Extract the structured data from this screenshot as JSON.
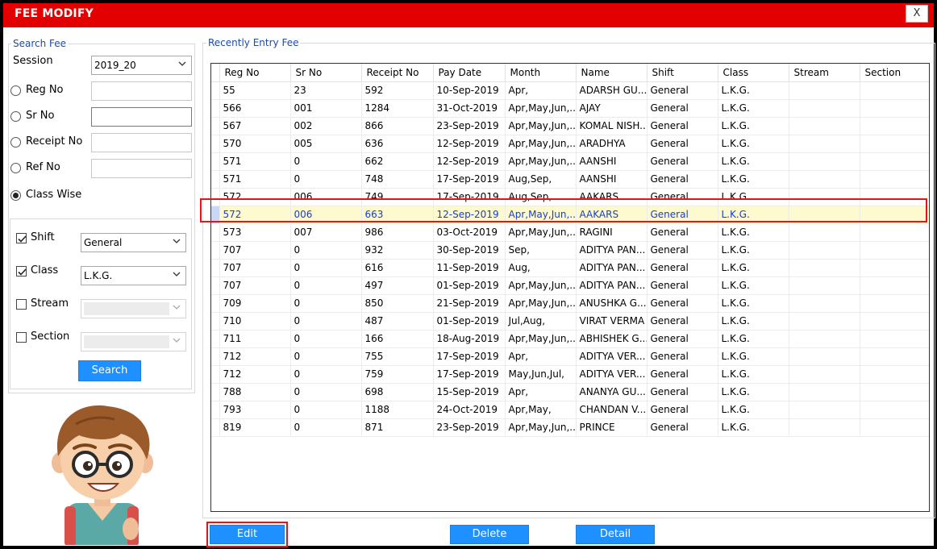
{
  "window": {
    "title": "FEE MODIFY",
    "close_label": "X"
  },
  "search_fee": {
    "legend": "Search Fee",
    "session_label": "Session",
    "session_value": "2019_20",
    "options": [
      {
        "label": "Reg No",
        "checked": false
      },
      {
        "label": "Sr No",
        "checked": false
      },
      {
        "label": "Receipt No",
        "checked": false
      },
      {
        "label": "Ref No",
        "checked": false
      },
      {
        "label": "Class Wise",
        "checked": true
      }
    ],
    "filters": {
      "shift_label": "Shift",
      "shift_checked": true,
      "shift_value": "General",
      "class_label": "Class",
      "class_checked": true,
      "class_value": "L.K.G.",
      "stream_label": "Stream",
      "stream_checked": false,
      "stream_value": "",
      "section_label": "Section",
      "section_checked": false,
      "section_value": ""
    },
    "search_label": "Search"
  },
  "recent": {
    "legend": "Recently Entry Fee",
    "columns": [
      "Reg No",
      "Sr No",
      "Receipt No",
      "Pay Date",
      "Month",
      "Name",
      "Shift",
      "Class",
      "Stream",
      "Section"
    ],
    "selected_index": 7,
    "rows": [
      [
        "55",
        "23",
        "592",
        "10-Sep-2019",
        "Apr,",
        "ADARSH GU...",
        "General",
        "L.K.G.",
        "",
        ""
      ],
      [
        "566",
        "001",
        "1284",
        "31-Oct-2019",
        "Apr,May,Jun,...",
        "AJAY",
        "General",
        "L.K.G.",
        "",
        ""
      ],
      [
        "567",
        "002",
        "866",
        "23-Sep-2019",
        "Apr,May,Jun,...",
        "KOMAL NISH...",
        "General",
        "L.K.G.",
        "",
        ""
      ],
      [
        "570",
        "005",
        "636",
        "12-Sep-2019",
        "Apr,May,Jun,...",
        "ARADHYA",
        "General",
        "L.K.G.",
        "",
        ""
      ],
      [
        "571",
        "0",
        "662",
        "12-Sep-2019",
        "Apr,May,Jun,...",
        "AANSHI",
        "General",
        "L.K.G.",
        "",
        ""
      ],
      [
        "571",
        "0",
        "748",
        "17-Sep-2019",
        "Aug,Sep,",
        "AANSHI",
        "General",
        "L.K.G.",
        "",
        ""
      ],
      [
        "572",
        "006",
        "749",
        "17-Sep-2019",
        "Aug,Sep,",
        "AAKARS",
        "General",
        "L.K.G.",
        "",
        ""
      ],
      [
        "572",
        "006",
        "663",
        "12-Sep-2019",
        "Apr,May,Jun,...",
        "AAKARS",
        "General",
        "L.K.G.",
        "",
        ""
      ],
      [
        "573",
        "007",
        "986",
        "03-Oct-2019",
        "Apr,May,Jun,...",
        "RAGINI",
        "General",
        "L.K.G.",
        "",
        ""
      ],
      [
        "707",
        "0",
        "932",
        "30-Sep-2019",
        "Sep,",
        "ADITYA PAN...",
        "General",
        "L.K.G.",
        "",
        ""
      ],
      [
        "707",
        "0",
        "616",
        "11-Sep-2019",
        "Aug,",
        "ADITYA PAN...",
        "General",
        "L.K.G.",
        "",
        ""
      ],
      [
        "707",
        "0",
        "497",
        "01-Sep-2019",
        "Apr,May,Jun,...",
        "ADITYA PAN...",
        "General",
        "L.K.G.",
        "",
        ""
      ],
      [
        "709",
        "0",
        "850",
        "21-Sep-2019",
        "Apr,May,Jun,...",
        "ANUSHKA G...",
        "General",
        "L.K.G.",
        "",
        ""
      ],
      [
        "710",
        "0",
        "487",
        "01-Sep-2019",
        "Jul,Aug,",
        "VIRAT VERMA",
        "General",
        "L.K.G.",
        "",
        ""
      ],
      [
        "711",
        "0",
        "166",
        "18-Aug-2019",
        "Apr,May,Jun,...",
        "ABHISHEK G...",
        "General",
        "L.K.G.",
        "",
        ""
      ],
      [
        "712",
        "0",
        "755",
        "17-Sep-2019",
        "Apr,",
        "ADITYA VER...",
        "General",
        "L.K.G.",
        "",
        ""
      ],
      [
        "712",
        "0",
        "759",
        "17-Sep-2019",
        "May,Jun,Jul,",
        "ADITYA VER...",
        "General",
        "L.K.G.",
        "",
        ""
      ],
      [
        "788",
        "0",
        "698",
        "15-Sep-2019",
        "Apr,",
        "ANANYA GU...",
        "General",
        "L.K.G.",
        "",
        ""
      ],
      [
        "793",
        "0",
        "1188",
        "24-Oct-2019",
        "Apr,May,",
        "CHANDAN V...",
        "General",
        "L.K.G.",
        "",
        ""
      ],
      [
        "819",
        "0",
        "871",
        "23-Sep-2019",
        "Apr,May,Jun,...",
        "PRINCE",
        "General",
        "L.K.G.",
        "",
        ""
      ]
    ]
  },
  "actions": {
    "edit_label": "Edit",
    "delete_label": "Delete",
    "detail_label": "Detail"
  },
  "colors": {
    "title_bar": "#e30000",
    "accent_blue": "#1e90ff",
    "highlight": "#e0161b",
    "selected_row": "#fdfad0"
  }
}
